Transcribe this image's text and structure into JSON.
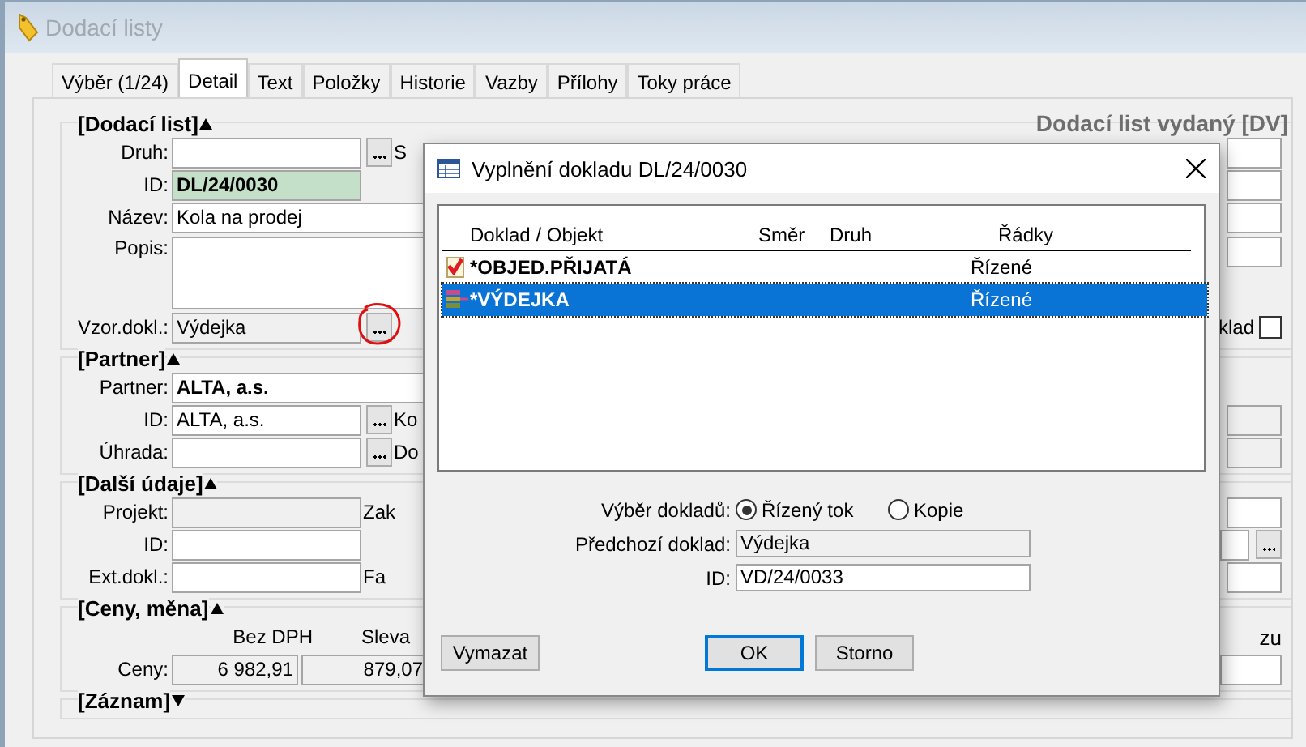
{
  "window": {
    "title": "Dodací listy"
  },
  "tabs": [
    {
      "label": "Výběr (1/24)",
      "selected": false
    },
    {
      "label": "Detail",
      "selected": true
    },
    {
      "label": "Text",
      "selected": false
    },
    {
      "label": "Položky",
      "selected": false
    },
    {
      "label": "Historie",
      "selected": false
    },
    {
      "label": "Vazby",
      "selected": false
    },
    {
      "label": "Přílohy",
      "selected": false
    },
    {
      "label": "Toky práce",
      "selected": false
    }
  ],
  "document_type": "Dodací list vydaný [DV]",
  "sections": [
    {
      "title": "[Dodací list]",
      "expanded": true,
      "rows": [
        {
          "label": "Druh:",
          "kind": "text",
          "value": "",
          "lookup": true,
          "side_label": "S",
          "right": {
            "kind": "field"
          }
        },
        {
          "label": "ID:",
          "kind": "key",
          "value": "DL/24/0030",
          "lookup": false,
          "right": {
            "kind": "field"
          }
        },
        {
          "label": "Název:",
          "kind": "wide",
          "value": "Kola na prodej",
          "lookup": false,
          "right": {
            "kind": "field"
          }
        },
        {
          "label": "Popis:",
          "kind": "memo",
          "value": "",
          "lookup": false,
          "right": {
            "kind": "field"
          }
        },
        {
          "label": "Vzor.dokl.:",
          "kind": "readonly",
          "value": "Výdejka",
          "lookup": true,
          "circled": true,
          "right": {
            "kind": "checkbox",
            "label": "klad",
            "checked": false
          }
        }
      ]
    },
    {
      "title": "[Partner]",
      "expanded": true,
      "rows": [
        {
          "label": "Partner:",
          "kind": "bold",
          "value": "ALTA, a.s.",
          "lookup": false
        },
        {
          "label": "ID:",
          "kind": "text",
          "value": "ALTA, a.s.",
          "lookup": true,
          "side_label": "Ko",
          "right": {
            "kind": "readonly_field"
          }
        },
        {
          "label": "Úhrada:",
          "kind": "text",
          "value": "",
          "lookup": true,
          "side_label": "Do",
          "right": {
            "kind": "readonly_field"
          }
        }
      ]
    },
    {
      "title": "[Další údaje]",
      "expanded": true,
      "rows": [
        {
          "label": "Projekt:",
          "kind": "readonly",
          "value": "",
          "lookup": false,
          "side_label": "Zak",
          "right": {
            "kind": "field"
          }
        },
        {
          "label": "ID:",
          "kind": "text",
          "value": "",
          "lookup": false,
          "right": {
            "kind": "lookup_field"
          }
        },
        {
          "label": "Ext.dokl.:",
          "kind": "text",
          "value": "",
          "lookup": false,
          "side_label": "Fa",
          "right": {
            "kind": "field"
          }
        }
      ]
    },
    {
      "title": "[Ceny, měna]",
      "expanded": true,
      "prices": {
        "headers": [
          "Bez DPH",
          "Sleva"
        ],
        "right_header": "zu",
        "label": "Ceny:",
        "values": [
          "6 982,91",
          "879,07"
        ]
      }
    },
    {
      "title": "[Záznam]",
      "expanded": false
    }
  ],
  "dialog": {
    "title": "Vyplnění dokladu DL/24/0030",
    "columns": [
      "Doklad / Objekt",
      "Směr",
      "Druh",
      "Řádky"
    ],
    "rows": [
      {
        "kind": "order",
        "name": "*OBJED.PŘIJATÁ",
        "lines": "Řízené",
        "selected": false
      },
      {
        "kind": "issue",
        "name": "*VÝDEJKA",
        "lines": "Řízené",
        "selected": true
      }
    ],
    "selection_label": "Výběr dokladů:",
    "options": [
      {
        "label": "Řízený tok",
        "selected": true
      },
      {
        "label": "Kopie",
        "selected": false
      }
    ],
    "previous_label": "Předchozí doklad:",
    "previous_value": "Výdejka",
    "id_label": "ID:",
    "id_value": "VD/24/0033",
    "buttons": [
      {
        "label": "Vymazat",
        "default": false
      },
      {
        "label": "OK",
        "default": true
      },
      {
        "label": "Storno",
        "default": false
      }
    ]
  }
}
